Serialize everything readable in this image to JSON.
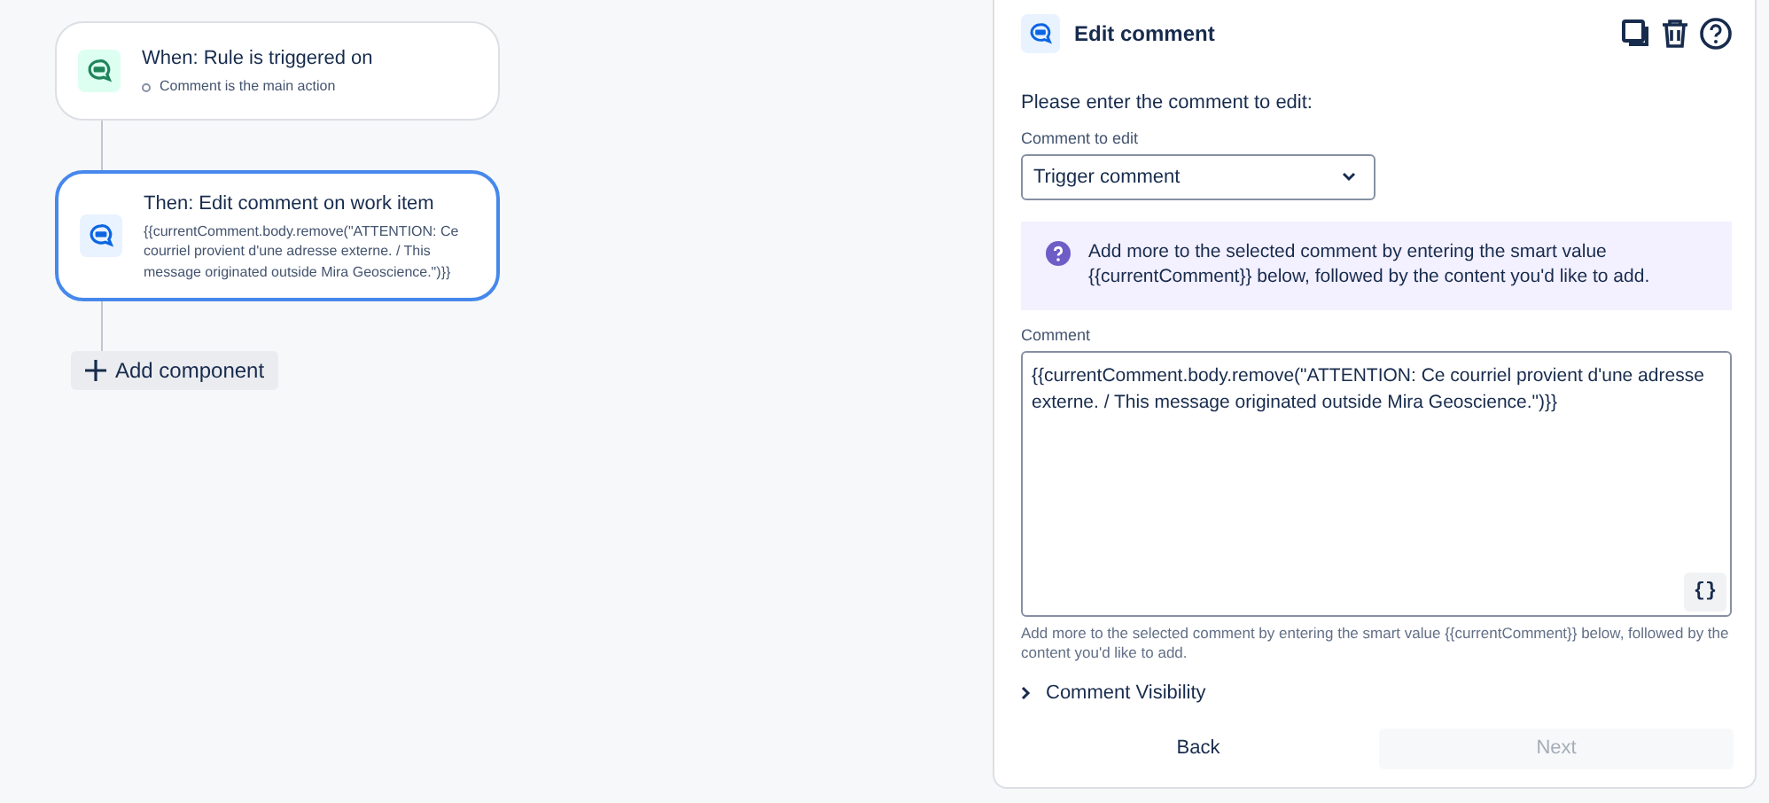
{
  "flow": {
    "cards": [
      {
        "kind": "trigger",
        "title": "When: Rule is triggered on",
        "lines": [
          "Comment is the main action"
        ],
        "selected": false
      },
      {
        "kind": "action",
        "title": "Then: Edit comment on work item",
        "lines": [
          "{{currentComment.body.remove(\"ATTENTION: Ce courriel provient d'une adresse externe. / This message originated outside Mira Geoscience.\")}}"
        ],
        "selected": true
      }
    ],
    "add_button": "Add component"
  },
  "panel": {
    "title": "Edit comment",
    "intro": "Please enter the comment to edit:",
    "select": {
      "label": "Comment to edit",
      "value": "Trigger comment"
    },
    "info": "Add more to the selected comment by entering the smart value {{currentComment}} below, followed by the content you'd like to add.",
    "comment": {
      "label": "Comment",
      "value": "{{currentComment.body.remove(\"ATTENTION: Ce courriel provient d'une adresse externe. / This message originated outside Mira Geoscience.\")}}",
      "smart_button": "{}",
      "help": "Add more to the selected comment by entering the smart value {{currentComment}} below, followed by the content you'd like to add."
    },
    "visibility": {
      "label": "Comment Visibility",
      "expanded": false
    },
    "buttons": [
      {
        "label": "Back",
        "disabled": false
      },
      {
        "label": "Next",
        "disabled": true
      }
    ]
  }
}
